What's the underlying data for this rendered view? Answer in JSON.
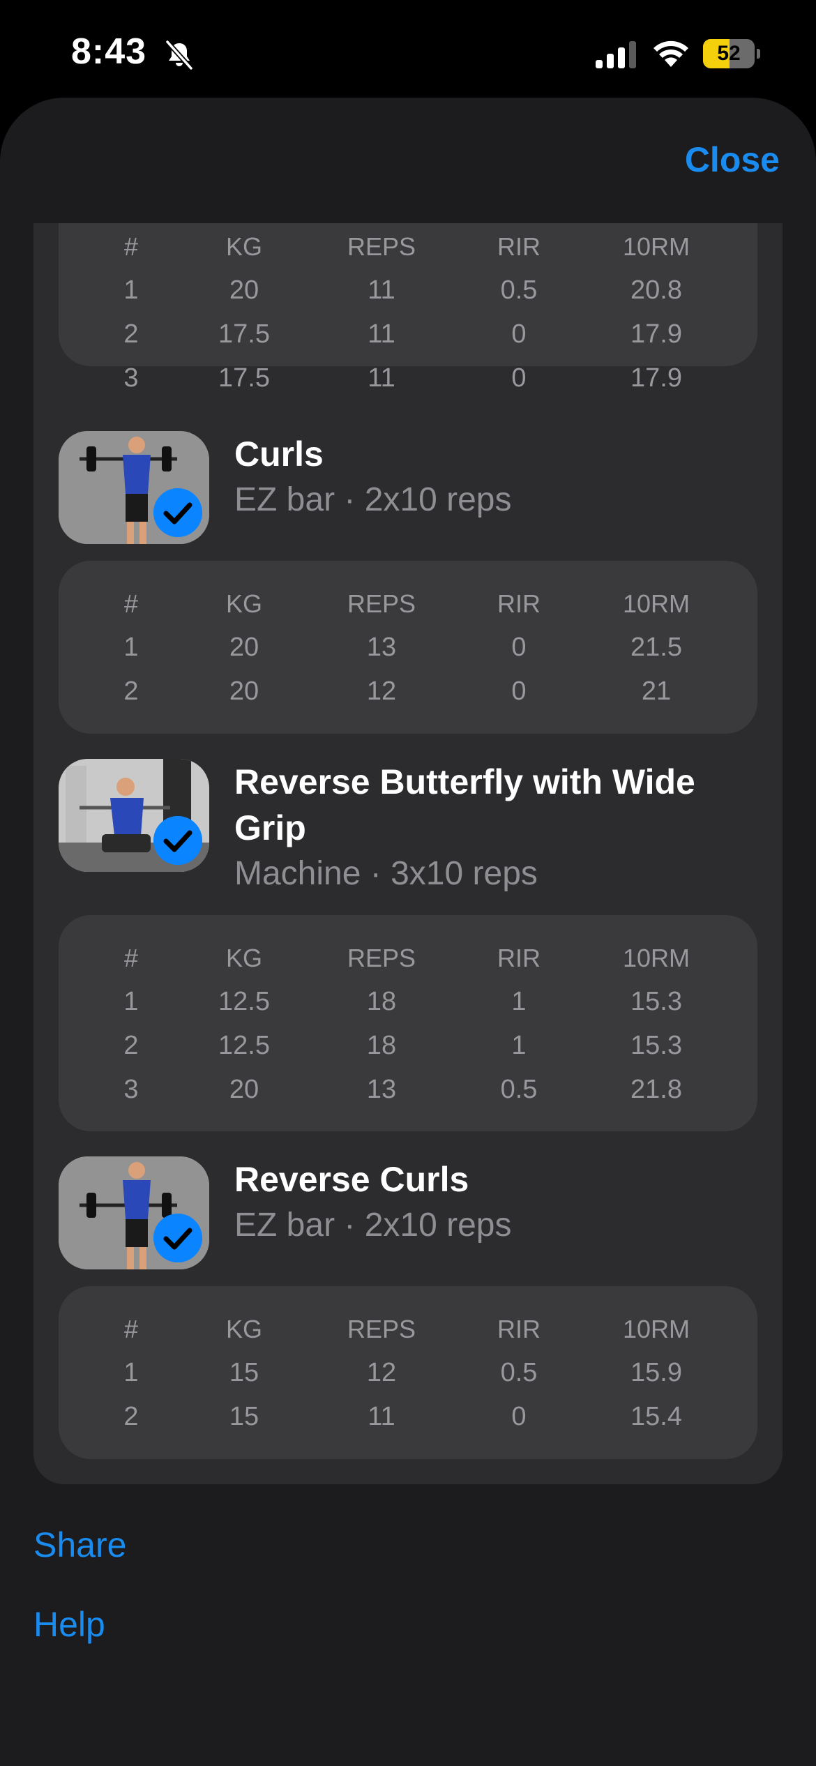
{
  "status_bar": {
    "time": "8:43",
    "battery": "52",
    "battery_level": 0.52,
    "icons": [
      "bell-slash-icon",
      "cellular-signal-icon",
      "wifi-icon",
      "battery-icon"
    ]
  },
  "header": {
    "close_label": "Close"
  },
  "colors": {
    "accent": "#1a8cf0",
    "sheet_bg": "#1c1c1e",
    "card_bg": "#2c2c2e",
    "sets_bg": "#3a3a3c",
    "check_badge": "#0a84ff",
    "battery_yellow": "#f4cf0b"
  },
  "columns": [
    "#",
    "KG",
    "REPS",
    "RIR",
    "10RM"
  ],
  "first_sets": [
    [
      "1",
      "20",
      "11",
      "0.5",
      "20.8"
    ],
    [
      "2",
      "17.5",
      "11",
      "0",
      "17.9"
    ],
    [
      "3",
      "17.5",
      "11",
      "0",
      "17.9"
    ]
  ],
  "exercises": [
    {
      "title": "Curls",
      "subtitle": "EZ bar · 2x10 reps",
      "completed": true,
      "sets": [
        [
          "1",
          "20",
          "13",
          "0",
          "21.5"
        ],
        [
          "2",
          "20",
          "12",
          "0",
          "21"
        ]
      ]
    },
    {
      "title": "Reverse Butterfly with Wide Grip",
      "subtitle": "Machine · 3x10 reps",
      "completed": true,
      "sets": [
        [
          "1",
          "12.5",
          "18",
          "1",
          "15.3"
        ],
        [
          "2",
          "12.5",
          "18",
          "1",
          "15.3"
        ],
        [
          "3",
          "20",
          "13",
          "0.5",
          "21.8"
        ]
      ]
    },
    {
      "title": "Reverse Curls",
      "subtitle": "EZ bar · 2x10 reps",
      "completed": true,
      "sets": [
        [
          "1",
          "15",
          "12",
          "0.5",
          "15.9"
        ],
        [
          "2",
          "15",
          "11",
          "0",
          "15.4"
        ]
      ]
    }
  ],
  "footer": {
    "share_label": "Share",
    "help_label": "Help"
  }
}
